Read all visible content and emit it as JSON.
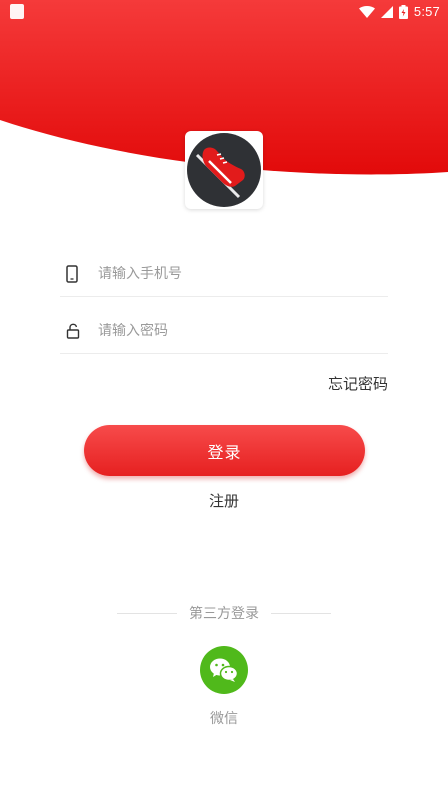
{
  "status_bar": {
    "time": "5:57"
  },
  "login": {
    "phone_placeholder": "请输入手机号",
    "password_placeholder": "请输入密码",
    "forgot_password": "忘记密码",
    "login_button": "登录",
    "register": "注册"
  },
  "third_party": {
    "title": "第三方登录",
    "wechat_label": "微信"
  },
  "colors": {
    "brand_red": "#e62020",
    "wechat_green": "#50b91b"
  },
  "icons": [
    "phone-icon",
    "lock-icon",
    "wechat-icon",
    "sneaker-logo-icon",
    "wifi-icon",
    "signal-icon",
    "battery-icon"
  ]
}
